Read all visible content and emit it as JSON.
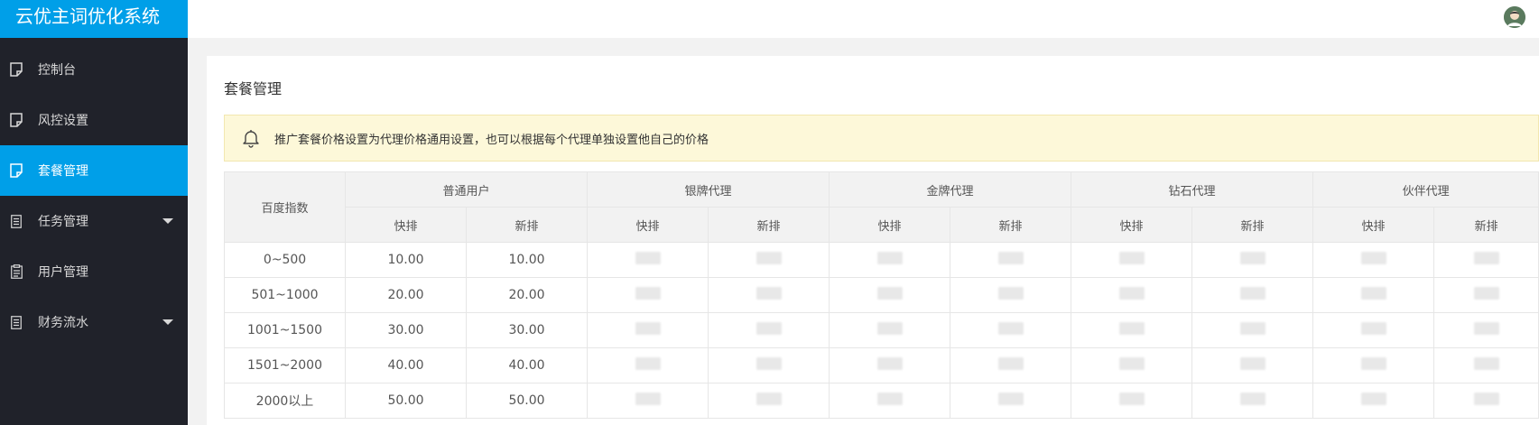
{
  "app": {
    "title": "云优主词优化系统"
  },
  "sidebar": {
    "items": [
      {
        "label": "控制台",
        "active": false,
        "has_submenu": false,
        "icon": "document-icon"
      },
      {
        "label": "风控设置",
        "active": false,
        "has_submenu": false,
        "icon": "document-icon"
      },
      {
        "label": "套餐管理",
        "active": true,
        "has_submenu": false,
        "icon": "document-icon"
      },
      {
        "label": "任务管理",
        "active": false,
        "has_submenu": true,
        "icon": "list-document-icon"
      },
      {
        "label": "用户管理",
        "active": false,
        "has_submenu": false,
        "icon": "clipboard-icon"
      },
      {
        "label": "财务流水",
        "active": false,
        "has_submenu": true,
        "icon": "list-document-icon"
      }
    ]
  },
  "page": {
    "title": "套餐管理",
    "notice": "推广套餐价格设置为代理价格通用设置，也可以根据每个代理单独设置他自己的价格"
  },
  "table": {
    "row_header": "百度指数",
    "groups": [
      "普通用户",
      "银牌代理",
      "金牌代理",
      "钻石代理",
      "伙伴代理"
    ],
    "sub_headers": [
      "快排",
      "新排"
    ],
    "rows": [
      {
        "range": "0~500",
        "normal_fast": "10.00",
        "normal_new": "10.00"
      },
      {
        "range": "501~1000",
        "normal_fast": "20.00",
        "normal_new": "20.00"
      },
      {
        "range": "1001~1500",
        "normal_fast": "30.00",
        "normal_new": "30.00"
      },
      {
        "range": "1501~2000",
        "normal_fast": "40.00",
        "normal_new": "40.00"
      },
      {
        "range": "2000以上",
        "normal_fast": "50.00",
        "normal_new": "50.00"
      }
    ]
  },
  "colors": {
    "sidebar_bg": "#20222a",
    "accent": "#009fe8",
    "notice_bg": "#fdf8d9"
  }
}
